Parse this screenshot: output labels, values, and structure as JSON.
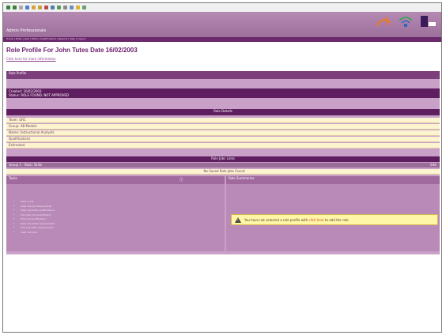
{
  "header": {
    "brand": "Admin Professionals"
  },
  "page": {
    "title": "Role Profile For John Tutes Date 16/02/2003",
    "link": "Click here for more information"
  },
  "panel": {
    "section_title": "Role Profile",
    "details": [
      "Created: 16/02/2003",
      "Status: ROLE FOUND, NOT APPROVED"
    ],
    "band_headers": {
      "role_details": "Role Details",
      "role_jobs": "Role Jobs Links",
      "no_jobs": "No Saved Role Jobs Found"
    },
    "detail_rows": [
      "Team: GRC",
      "Group: AB Models",
      "Name: Instructional Analysts",
      "Qualifications",
      "Estimated"
    ],
    "jobs_row_left": "Group 1 - Basic Skills",
    "jobs_row_right": "Edit",
    "left_col": {
      "title": "Tasks",
      "bullets": [
        "View a role",
        "View role job assignments",
        "View role skills qualifications",
        "Add new role qualification",
        "Edit role qualification",
        "View role skills requirements",
        "Edit role skills requirements",
        "View role jobs"
      ]
    },
    "right_col": {
      "title": "Role Summaries",
      "warning_text": "You have not selected a role profile with ",
      "warning_link": "click here",
      "warning_tail": " to add the role."
    }
  },
  "colors": {
    "header_purple": "#9d6f9c",
    "band_dark": "#5e1e5f",
    "panel_light": "#c9a0c7",
    "row_cream": "#fbf4cf",
    "warning_yellow": "#fff6a8"
  }
}
